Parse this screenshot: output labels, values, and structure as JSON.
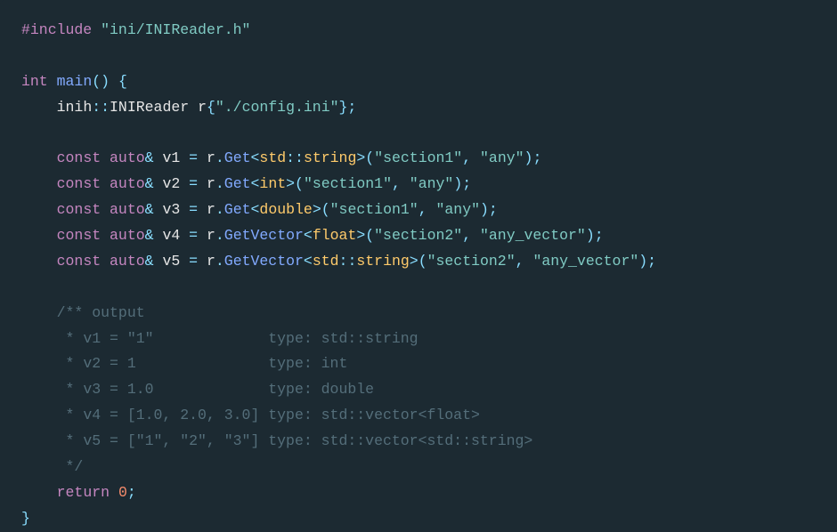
{
  "code": {
    "l1": {
      "include": "#include",
      "path": "\"ini/INIReader.h\""
    },
    "l2": {
      "kw_int": "int",
      "fn_main": "main",
      "parens": "()",
      "brace": "{"
    },
    "l3": {
      "ns": "inih",
      "cls": "INIReader",
      "var": "r",
      "brace_open": "{",
      "str": "\"./config.ini\"",
      "brace_close": "}",
      "semi": ";"
    },
    "v1": {
      "const": "const",
      "auto": "auto",
      "amp": "&",
      "var": "v1",
      "eq": "=",
      "obj": "r",
      "dot": ".",
      "fn": "Get",
      "lt": "<",
      "t1": "std",
      "cc": "::",
      "t2": "string",
      "gt": ">",
      "po": "(",
      "a1": "\"section1\"",
      "comma": ",",
      "a2": "\"any\"",
      "pc": ")",
      "semi": ";"
    },
    "v2": {
      "const": "const",
      "auto": "auto",
      "amp": "&",
      "var": "v2",
      "eq": "=",
      "obj": "r",
      "dot": ".",
      "fn": "Get",
      "lt": "<",
      "typ": "int",
      "gt": ">",
      "po": "(",
      "a1": "\"section1\"",
      "comma": ",",
      "a2": "\"any\"",
      "pc": ")",
      "semi": ";"
    },
    "v3": {
      "const": "const",
      "auto": "auto",
      "amp": "&",
      "var": "v3",
      "eq": "=",
      "obj": "r",
      "dot": ".",
      "fn": "Get",
      "lt": "<",
      "typ": "double",
      "gt": ">",
      "po": "(",
      "a1": "\"section1\"",
      "comma": ",",
      "a2": "\"any\"",
      "pc": ")",
      "semi": ";"
    },
    "v4": {
      "const": "const",
      "auto": "auto",
      "amp": "&",
      "var": "v4",
      "eq": "=",
      "obj": "r",
      "dot": ".",
      "fn": "GetVector",
      "lt": "<",
      "typ": "float",
      "gt": ">",
      "po": "(",
      "a1": "\"section2\"",
      "comma": ",",
      "a2": "\"any_vector\"",
      "pc": ")",
      "semi": ";"
    },
    "v5": {
      "const": "const",
      "auto": "auto",
      "amp": "&",
      "var": "v5",
      "eq": "=",
      "obj": "r",
      "dot": ".",
      "fn": "GetVector",
      "lt": "<",
      "t1": "std",
      "cc": "::",
      "t2": "string",
      "gt": ">",
      "po": "(",
      "a1": "\"section2\"",
      "comma": ",",
      "a2": "\"any_vector\"",
      "pc": ")",
      "semi": ";"
    },
    "comment": {
      "c1": "/** output",
      "c2": " * v1 = \"1\"             type: std::string",
      "c3": " * v2 = 1               type: int",
      "c4": " * v3 = 1.0             type: double",
      "c5": " * v4 = [1.0, 2.0, 3.0] type: std::vector<float>",
      "c6": " * v5 = [\"1\", \"2\", \"3\"] type: std::vector<std::string>",
      "c7": " */"
    },
    "ret": {
      "kw": "return",
      "num": "0",
      "semi": ";"
    },
    "end": {
      "brace": "}"
    }
  }
}
